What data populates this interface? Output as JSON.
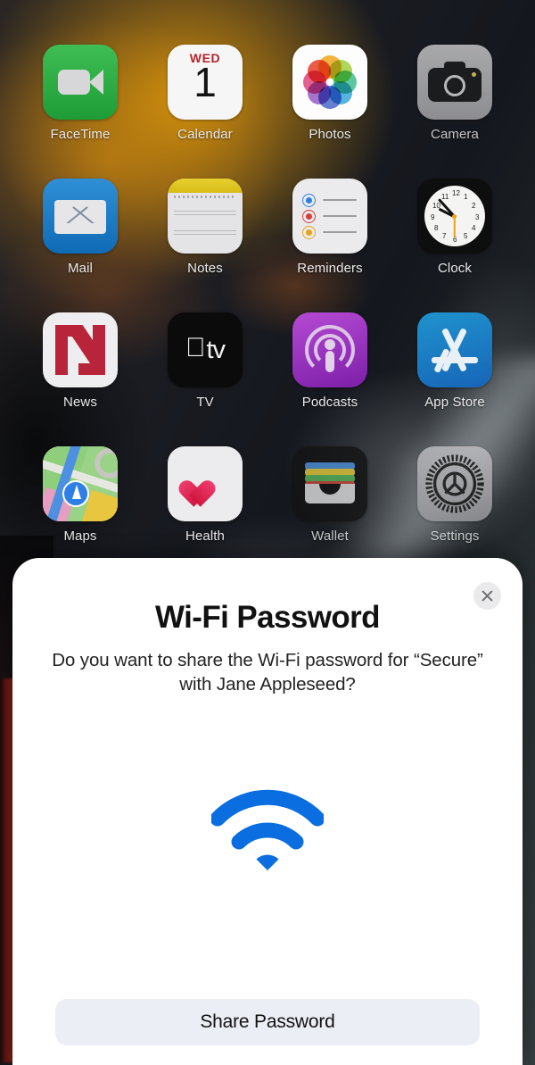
{
  "home_screen": {
    "apps": [
      {
        "label": "FaceTime",
        "icon": "facetime-icon"
      },
      {
        "label": "Calendar",
        "icon": "calendar-icon",
        "weekday": "WED",
        "day": "1"
      },
      {
        "label": "Photos",
        "icon": "photos-icon"
      },
      {
        "label": "Camera",
        "icon": "camera-icon"
      },
      {
        "label": "Mail",
        "icon": "mail-icon"
      },
      {
        "label": "Notes",
        "icon": "notes-icon"
      },
      {
        "label": "Reminders",
        "icon": "reminders-icon"
      },
      {
        "label": "Clock",
        "icon": "clock-icon"
      },
      {
        "label": "News",
        "icon": "news-icon"
      },
      {
        "label": "TV",
        "icon": "tv-icon",
        "glyph": "",
        "wordmark": "tv"
      },
      {
        "label": "Podcasts",
        "icon": "podcasts-icon"
      },
      {
        "label": "App Store",
        "icon": "app-store-icon"
      },
      {
        "label": "Maps",
        "icon": "maps-icon"
      },
      {
        "label": "Health",
        "icon": "health-icon"
      },
      {
        "label": "Wallet",
        "icon": "wallet-icon"
      },
      {
        "label": "Settings",
        "icon": "settings-icon"
      }
    ],
    "clock_numerals": [
      "12",
      "1",
      "2",
      "3",
      "4",
      "5",
      "6",
      "7",
      "8",
      "9",
      "10",
      "11"
    ]
  },
  "sheet": {
    "title": "Wi-Fi Password",
    "message": "Do you want to share the Wi-Fi password for “Secure” with Jane Appleseed?",
    "network_name": "Secure",
    "recipient": "Jane Appleseed",
    "wifi_icon": "wifi-icon",
    "close_icon": "close-icon",
    "share_label": "Share Password"
  },
  "colors": {
    "wifi_blue": "#0a6ee0",
    "sheet_background": "#ffffff",
    "button_background": "#eceef5",
    "close_background": "#eaeaec",
    "title_color": "#111111",
    "calendar_red": "#b4252c",
    "news_red": "#b8253a",
    "health_red": "#ef3d6e"
  }
}
